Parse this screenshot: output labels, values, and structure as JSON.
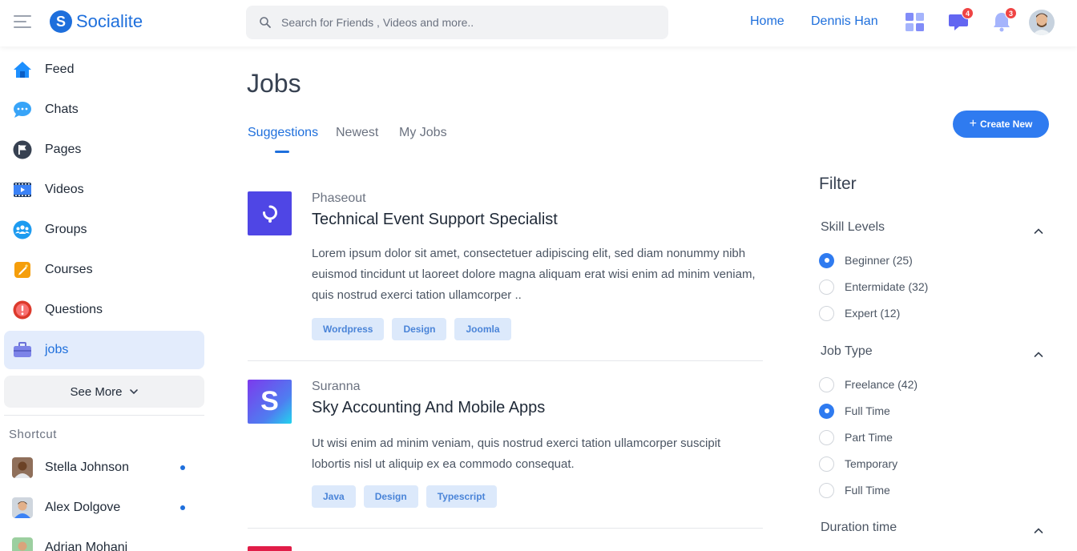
{
  "brand": {
    "logo_letter": "S",
    "name": "Socialite"
  },
  "search": {
    "placeholder": "Search for Friends , Videos and more.."
  },
  "header": {
    "home_link": "Home",
    "user_name": "Dennis Han",
    "messages_badge": "4",
    "notifications_badge": "3"
  },
  "sidebar": {
    "items": [
      {
        "label": "Feed",
        "icon": "home-icon"
      },
      {
        "label": "Chats",
        "icon": "chat-icon"
      },
      {
        "label": "Pages",
        "icon": "flag-icon"
      },
      {
        "label": "Videos",
        "icon": "video-icon"
      },
      {
        "label": "Groups",
        "icon": "groups-icon"
      },
      {
        "label": "Courses",
        "icon": "courses-icon"
      },
      {
        "label": "Questions",
        "icon": "question-icon"
      },
      {
        "label": "jobs",
        "icon": "briefcase-icon",
        "active": true
      }
    ],
    "see_more": "See More",
    "shortcut_title": "Shortcut",
    "shortcuts": [
      {
        "name": "Stella Johnson",
        "online": true
      },
      {
        "name": "Alex Dolgove",
        "online": true
      },
      {
        "name": "Adrian Mohani",
        "online": false
      }
    ]
  },
  "page": {
    "title": "Jobs",
    "tabs": [
      "Suggestions",
      "Newest",
      "My Jobs"
    ],
    "active_tab": "Suggestions",
    "create_button": "Create New"
  },
  "jobs": [
    {
      "company": "Phaseout",
      "title": "Technical Event Support Specialist",
      "description": "Lorem ipsum dolor sit amet, consectetuer adipiscing elit, sed diam nonummy nibh euismod tincidunt ut laoreet dolore magna aliquam erat wisi enim ad minim veniam, quis nostrud exerci tation ullamcorper ..",
      "tags": [
        "Wordpress",
        "Design",
        "Joomla"
      ]
    },
    {
      "company": "Suranna",
      "title": "Sky Accounting And Mobile Apps",
      "description": "Ut wisi enim ad minim veniam, quis nostrud exerci tation ullamcorper suscipit lobortis nisl ut aliquip ex ea commodo consequat.",
      "tags": [
        "Java",
        "Design",
        "Typescript"
      ],
      "logo_letter": "S"
    }
  ],
  "filter": {
    "title": "Filter",
    "skill_levels": {
      "title": "Skill Levels",
      "options": [
        "Beginner (25)",
        "Entermidate (32)",
        "Expert (12)"
      ],
      "selected": "Beginner (25)"
    },
    "job_type": {
      "title": "Job Type",
      "options": [
        "Freelance (42)",
        "Full Time",
        "Part Time",
        "Temporary",
        "Full Time"
      ],
      "selected_index": 1
    },
    "duration": {
      "title": "Duration time"
    }
  },
  "colors": {
    "accent": "#1e6fdc",
    "button": "#2f7bf0",
    "active_bg": "#e3ecfc",
    "tag_bg": "#dce9fb",
    "badge": "#ef4444"
  }
}
